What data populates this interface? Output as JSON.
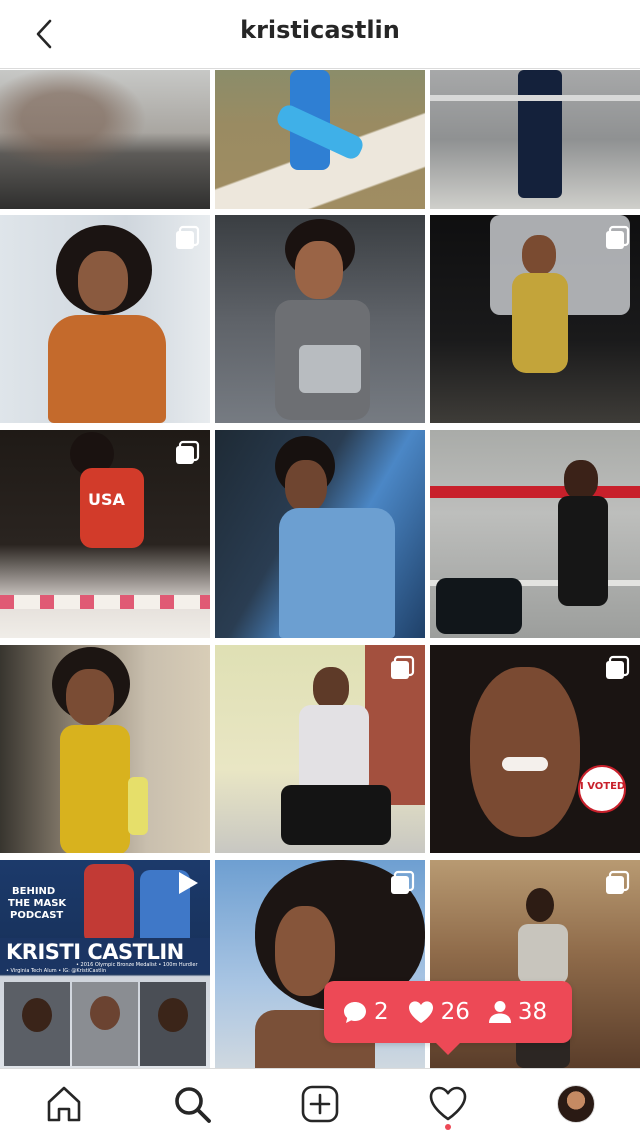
{
  "header": {
    "title": "kristicastlin",
    "back_icon": "chevron-left-icon"
  },
  "grid": {
    "tiles": [
      {
        "row": 1,
        "col": 1,
        "badge": "none",
        "caption_text": ""
      },
      {
        "row": 1,
        "col": 2,
        "badge": "none",
        "caption_text": ""
      },
      {
        "row": 1,
        "col": 3,
        "badge": "none",
        "caption_text": ""
      },
      {
        "row": 2,
        "col": 1,
        "badge": "multiple",
        "caption_text": ""
      },
      {
        "row": 2,
        "col": 2,
        "badge": "none",
        "caption_text": ""
      },
      {
        "row": 2,
        "col": 3,
        "badge": "multiple",
        "caption_text": ""
      },
      {
        "row": 3,
        "col": 1,
        "badge": "multiple",
        "caption_text": "USA"
      },
      {
        "row": 3,
        "col": 2,
        "badge": "none",
        "caption_text": ""
      },
      {
        "row": 3,
        "col": 3,
        "badge": "none",
        "caption_text": ""
      },
      {
        "row": 4,
        "col": 1,
        "badge": "none",
        "caption_text": ""
      },
      {
        "row": 4,
        "col": 2,
        "badge": "multiple",
        "caption_text": ""
      },
      {
        "row": 4,
        "col": 3,
        "badge": "multiple",
        "caption_text": "I VOTED"
      },
      {
        "row": 5,
        "col": 1,
        "badge": "video",
        "caption_text": "KRISTI CASTLIN"
      },
      {
        "row": 5,
        "col": 2,
        "badge": "multiple",
        "caption_text": ""
      },
      {
        "row": 5,
        "col": 3,
        "badge": "multiple",
        "caption_text": ""
      }
    ],
    "video_tile": {
      "podcast_line1": "BEHIND",
      "podcast_line2": "THE MASK",
      "podcast_line3": "PODCAST",
      "name": "KRISTI CASTLIN",
      "sub1": "• 2016 Olympic Bronze Medalist • 100m Hurdler",
      "sub2": "• Virginia Tech Alum • IG: @KristiCastlin"
    }
  },
  "activity": {
    "comments": "2",
    "likes": "26",
    "follows": "38",
    "color": "#ed4956"
  },
  "bottom_nav": {
    "items": [
      "home-icon",
      "search-icon",
      "new-post-icon",
      "activity-heart-icon",
      "profile-avatar"
    ],
    "active": "search-icon"
  }
}
